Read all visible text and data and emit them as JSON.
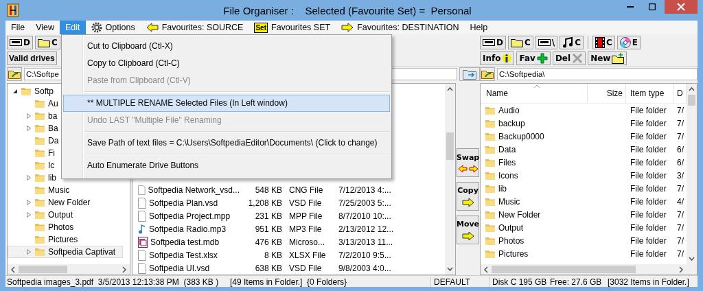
{
  "window": {
    "title": "File Organiser :    Selected (Favourite Set) =  Personal"
  },
  "menu_bar": [
    {
      "label": "File",
      "kind": "text",
      "selected": false
    },
    {
      "label": "View",
      "kind": "text",
      "selected": false
    },
    {
      "label": "Edit",
      "kind": "text",
      "selected": true
    },
    {
      "label": "Options",
      "kind": "gear",
      "selected": false
    },
    {
      "label": "Favourites: SOURCE",
      "kind": "arrow_left",
      "selected": false
    },
    {
      "label": "Favourites SET",
      "kind": "set",
      "icon_text": "Set",
      "selected": false
    },
    {
      "label": "Favourites: DESTINATION",
      "kind": "arrow_right",
      "selected": false
    },
    {
      "label": "Help",
      "kind": "text",
      "selected": false
    }
  ],
  "edit_menu": [
    {
      "kind": "item",
      "label": "Cut to Clipboard (Ctl-X)",
      "disabled": false,
      "selected": false
    },
    {
      "kind": "item",
      "label": "Copy to Clipboard (Ctl-C)",
      "disabled": false,
      "selected": false
    },
    {
      "kind": "item",
      "label": "Paste from Clipboard  (Ctl-V)",
      "disabled": true,
      "selected": false
    },
    {
      "kind": "separator"
    },
    {
      "kind": "item",
      "label": "** MULTIPLE RENAME Selected Files (In Left window)",
      "disabled": false,
      "selected": true
    },
    {
      "kind": "item",
      "label": "Undo LAST  \"Multiple File\" Renaming",
      "disabled": true,
      "selected": false
    },
    {
      "kind": "separator"
    },
    {
      "kind": "item",
      "label": "Save Path of text files = C:\\Users\\SoftpediaEditor\\Documents\\ (Click to change)",
      "disabled": false,
      "selected": false
    },
    {
      "kind": "separator"
    },
    {
      "kind": "item",
      "label": "Auto Enumerate Drive Buttons",
      "disabled": false,
      "selected": false
    }
  ],
  "left_panel": {
    "drive_buttons": [
      {
        "kind": "drive",
        "label": "D"
      },
      {
        "kind": "folder",
        "label": "C"
      }
    ],
    "valid_drives_button": "Valid drives",
    "path": "C:\\Softpe",
    "tree": [
      {
        "label": "Softp",
        "expanded": true,
        "selected": false,
        "children": [
          {
            "label": "Au",
            "has_children": false,
            "selected": false
          },
          {
            "label": "ba",
            "has_children": true,
            "selected": false
          },
          {
            "label": "Ba",
            "has_children": true,
            "selected": false
          },
          {
            "label": "Da",
            "has_children": false,
            "selected": false
          },
          {
            "label": "Fi",
            "has_children": false,
            "selected": false
          },
          {
            "label": "Ic",
            "has_children": false,
            "selected": false
          },
          {
            "label": "lib",
            "has_children": true,
            "selected": false
          },
          {
            "label": "Music",
            "has_children": false,
            "selected": false
          },
          {
            "label": "New Folder",
            "has_children": true,
            "selected": false
          },
          {
            "label": "Output",
            "has_children": true,
            "selected": false
          },
          {
            "label": "Photos",
            "has_children": false,
            "selected": false
          },
          {
            "label": "Pictures",
            "has_children": false,
            "selected": false
          },
          {
            "label": "Softpedia Captivat",
            "has_children": true,
            "selected": true
          }
        ]
      }
    ],
    "files": [
      {
        "kind": "document",
        "name": "Softpedia Network_vsd...",
        "size": "548 KB",
        "type": "CNG File",
        "date": "7/12/2013 4:..."
      },
      {
        "kind": "document",
        "name": "Softpedia Plan.vsd",
        "size": "1,208 KB",
        "type": "VSD File",
        "date": "7/25/2003 5:..."
      },
      {
        "kind": "document",
        "name": "Softpedia Project.mpp",
        "size": "231 KB",
        "type": "MPP File",
        "date": "8/7/2010 10:..."
      },
      {
        "kind": "audio",
        "name": "Softpedia Radio.mp3",
        "size": "951 KB",
        "type": "MP3 File",
        "date": "2/13/2012 12..."
      },
      {
        "kind": "database",
        "name": "Softpedia test.mdb",
        "size": "476 KB",
        "type": "Microso...",
        "date": "3/13/2013 11..."
      },
      {
        "kind": "document",
        "name": "Softpedia Test.xlsx",
        "size": "8 KB",
        "type": "XLSX File",
        "date": "7/2/2010 9:5..."
      },
      {
        "kind": "document",
        "name": "Softpedia UI.vsd",
        "size": "638 KB",
        "type": "VSD File",
        "date": "9/8/2003 4:0..."
      }
    ]
  },
  "transfer_buttons": [
    {
      "label": "Swap",
      "kind": "swap"
    },
    {
      "label": "Copy",
      "kind": "forward"
    },
    {
      "label": "Move",
      "kind": "forward"
    }
  ],
  "right_panel": {
    "drive_groups": [
      [
        {
          "kind": "drive",
          "label": "D"
        },
        {
          "kind": "folder",
          "label": "C"
        },
        {
          "kind": "drive",
          "label": "\\"
        },
        {
          "kind": "music",
          "label": "C"
        }
      ],
      [
        {
          "kind": "film",
          "label": "C"
        },
        {
          "kind": "disc",
          "label": "E"
        }
      ]
    ],
    "action_buttons": [
      {
        "label": "Info",
        "kind": "info"
      },
      {
        "label": "Fav",
        "kind": "add"
      },
      {
        "label": "Del",
        "kind": "delete"
      },
      {
        "label": "New",
        "kind": "new"
      }
    ],
    "path": "C:\\Softpedia\\",
    "columns": [
      {
        "label": "Name",
        "sorted": true
      },
      {
        "label": "Size",
        "sorted": false
      },
      {
        "label": "Item type",
        "sorted": false
      },
      {
        "label": "D",
        "sorted": false
      }
    ],
    "rows": [
      {
        "name": "Audio",
        "type": "File folder",
        "date": "7/"
      },
      {
        "name": "backup",
        "type": "File folder",
        "date": "7/"
      },
      {
        "name": "Backup0000",
        "type": "File folder",
        "date": "7/"
      },
      {
        "name": "Data",
        "type": "File folder",
        "date": "6/"
      },
      {
        "name": "Files",
        "type": "File folder",
        "date": "6/"
      },
      {
        "name": "Icons",
        "type": "File folder",
        "date": "3/"
      },
      {
        "name": "lib",
        "type": "File folder",
        "date": "7/"
      },
      {
        "name": "Music",
        "type": "File folder",
        "date": "4/"
      },
      {
        "name": "New Folder",
        "type": "File folder",
        "date": "7/"
      },
      {
        "name": "Output",
        "type": "File folder",
        "date": "7/"
      },
      {
        "name": "Photos",
        "type": "File folder",
        "date": "7/"
      },
      {
        "name": "Pictures",
        "type": "File folder",
        "date": "7/"
      }
    ]
  },
  "status_bar": {
    "file_info": "Softpedia images_3.pdf  3/5/2013 12:13:38 PM  (383 KB )",
    "left_count": "[49 Items in Folder.]  {0 Folders}",
    "set_name": "DEFAULT",
    "disk": "Disk C 195 GB",
    "free": "Free: 27.6 GB",
    "right_count": "[3032 Items in Folder.]"
  }
}
